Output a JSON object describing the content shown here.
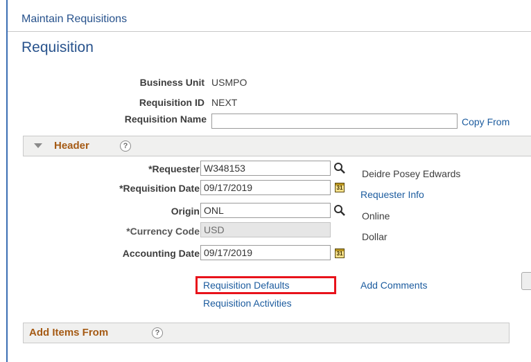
{
  "breadcrumb": "Maintain Requisitions",
  "page_title": "Requisition",
  "business_unit": {
    "label": "Business Unit",
    "value": "USMPO"
  },
  "requisition_id": {
    "label": "Requisition ID",
    "value": "NEXT"
  },
  "requisition_name": {
    "label": "Requisition Name",
    "value": ""
  },
  "copy_from": "Copy From",
  "header_section": {
    "title": "Header",
    "help": "?",
    "requester": {
      "label": "*Requester",
      "value": "W348153",
      "description": "Deidre Posey Edwards"
    },
    "requisition_date": {
      "label": "*Requisition Date",
      "value": "09/17/2019"
    },
    "requester_info": "Requester Info",
    "origin": {
      "label": "Origin",
      "value": "ONL",
      "description": "Online"
    },
    "currency_code": {
      "label": "*Currency Code",
      "value": "USD",
      "description": "Dollar"
    },
    "accounting_date": {
      "label": "Accounting Date",
      "value": "09/17/2019"
    },
    "calendar_icon_text": "31",
    "requisition_defaults": "Requisition Defaults",
    "requisition_activities": "Requisition Activities",
    "add_comments": "Add Comments"
  },
  "add_items_section": {
    "title": "Add Items From",
    "help": "?"
  },
  "icons": {
    "lookup": "magnifier-icon",
    "calendar": "calendar-icon",
    "help": "help-icon",
    "collapse": "collapse-triangle-icon"
  },
  "colors": {
    "frame_border": "#3a6db3",
    "title_blue": "#27528c",
    "link_blue": "#1b5b9e",
    "section_title": "#a55a14",
    "highlight_red": "#e8121b"
  }
}
